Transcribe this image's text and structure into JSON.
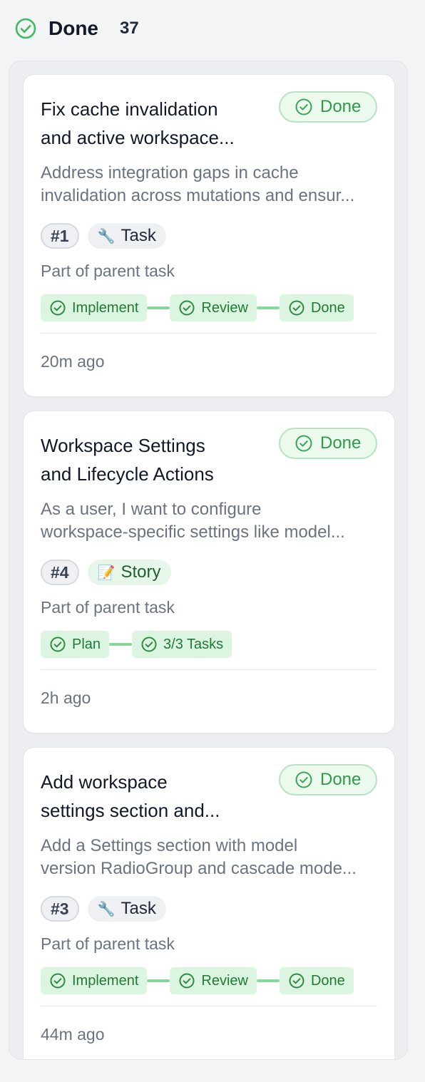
{
  "header": {
    "title": "Done",
    "count": "37",
    "icon": "check-circle-icon"
  },
  "colors": {
    "done_green": "#2e9a4a",
    "step_bg": "#dcf5e0",
    "muted": "#6b7280"
  },
  "cards": [
    {
      "title_lines": [
        "Fix cache invalidation",
        "and active workspace..."
      ],
      "status": "Done",
      "desc_lines": [
        "Address integration gaps in cache",
        "invalidation across mutations and ensur..."
      ],
      "id": "#1",
      "type": {
        "icon": "🔧",
        "label": "Task"
      },
      "parent": "Part of parent task",
      "steps": [
        "Implement",
        "Review",
        "Done"
      ],
      "time": "20m ago"
    },
    {
      "title_lines": [
        "Workspace Settings",
        "and Lifecycle Actions"
      ],
      "status": "Done",
      "desc_lines": [
        "As a user, I want to configure",
        "workspace-specific settings like model..."
      ],
      "id": "#4",
      "type": {
        "icon": "📝",
        "label": "Story"
      },
      "parent": "Part of parent task",
      "steps": [
        "Plan",
        "3/3 Tasks"
      ],
      "time": "2h ago"
    },
    {
      "title_lines": [
        "Add workspace",
        "settings section and..."
      ],
      "status": "Done",
      "desc_lines": [
        "Add a Settings section with model",
        "version RadioGroup and cascade mode..."
      ],
      "id": "#3",
      "type": {
        "icon": "🔧",
        "label": "Task"
      },
      "parent": "Part of parent task",
      "steps": [
        "Implement",
        "Review",
        "Done"
      ],
      "time": "44m ago"
    }
  ]
}
